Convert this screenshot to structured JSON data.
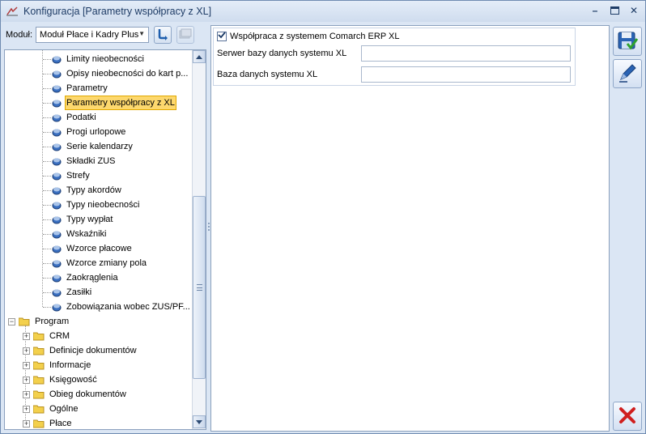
{
  "window": {
    "title": "Konfiguracja [Parametry współpracy z XL]",
    "controls": {
      "minimize": "–",
      "maximize": "▫",
      "close": "✕"
    }
  },
  "module": {
    "label": "Moduł:",
    "selected": "Moduł Płace i Kadry Plus"
  },
  "tree": {
    "leaf_items": [
      "Limity nieobecności",
      "Opisy nieobecności do kart p...",
      "Parametry",
      "Parametry współpracy z XL",
      "Podatki",
      "Progi urlopowe",
      "Serie kalendarzy",
      "Składki ZUS",
      "Strefy",
      "Typy akordów",
      "Typy nieobecności",
      "Typy wypłat",
      "Wskaźniki",
      "Wzorce płacowe",
      "Wzorce zmiany pola",
      "Zaokrąglenia",
      "Zasiłki",
      "Zobowiązania wobec ZUS/PF..."
    ],
    "selected_index": 3,
    "root": "Program",
    "folders": [
      "CRM",
      "Definicje dokumentów",
      "Informacje",
      "Księgowość",
      "Obieg dokumentów",
      "Ogólne",
      "Płace"
    ]
  },
  "form": {
    "group_checkbox_label": "Współpraca z systemem Comarch ERP XL",
    "group_checked": true,
    "server_label": "Serwer bazy danych systemu XL",
    "server_value": "",
    "database_label": "Baza danych systemu XL",
    "database_value": ""
  },
  "icons": {
    "save": "save-icon",
    "edit": "edit-icon",
    "cancel": "cancel-icon"
  },
  "colors": {
    "selection_bg": "#fdd86d",
    "frame": "#dbe6f4",
    "accent": "#1e3c66"
  }
}
